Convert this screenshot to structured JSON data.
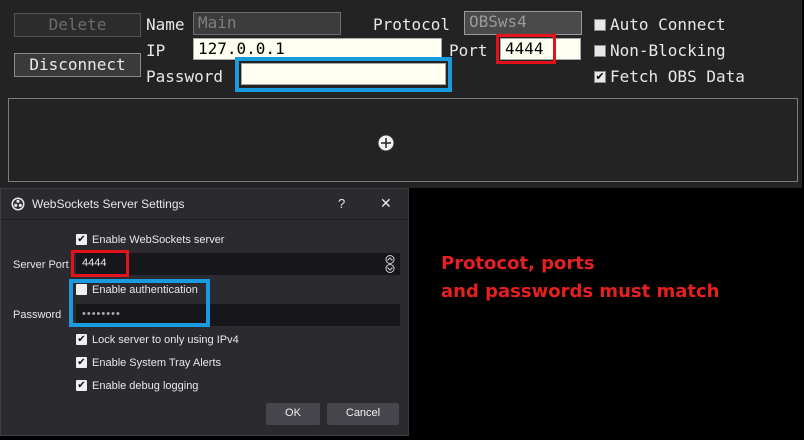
{
  "connection_panel": {
    "delete_label": "Delete",
    "disconnect_label": "Disconnect",
    "name_label": "Name",
    "name_value": "Main",
    "protocol_label": "Protocol",
    "protocol_value": "OBSws4",
    "ip_label": "IP",
    "ip_value": "127.0.0.1",
    "port_label": "Port",
    "port_value": "4444",
    "password_label": "Password",
    "password_value": "",
    "options": [
      {
        "label": "Auto Connect",
        "checked": false
      },
      {
        "label": "Non-Blocking",
        "checked": false
      },
      {
        "label": "Fetch OBS Data",
        "checked": true
      }
    ],
    "add_icon": "plus-circle-icon"
  },
  "dialog": {
    "title": "WebSockets Server Settings",
    "app_icon": "obs-logo-icon",
    "help_label": "?",
    "close_label": "✕",
    "enable_server_label": "Enable WebSockets server",
    "enable_server_checked": true,
    "server_port_label": "Server Port",
    "server_port_value": "4444",
    "enable_auth_label": "Enable authentication",
    "enable_auth_checked": false,
    "password_label": "Password",
    "password_value": "••••••••",
    "lock_ipv4_label": "Lock server to only using IPv4",
    "lock_ipv4_checked": true,
    "tray_alerts_label": "Enable System Tray Alerts",
    "tray_alerts_checked": true,
    "debug_logging_label": "Enable debug logging",
    "debug_logging_checked": true,
    "ok_label": "OK",
    "cancel_label": "Cancel"
  },
  "annotation": {
    "line1": "Protocot, ports",
    "line2": "and passwords must match"
  },
  "colors": {
    "highlight_red": "#e3121b",
    "highlight_blue": "#1a9be0",
    "note_text": "#e52020"
  }
}
